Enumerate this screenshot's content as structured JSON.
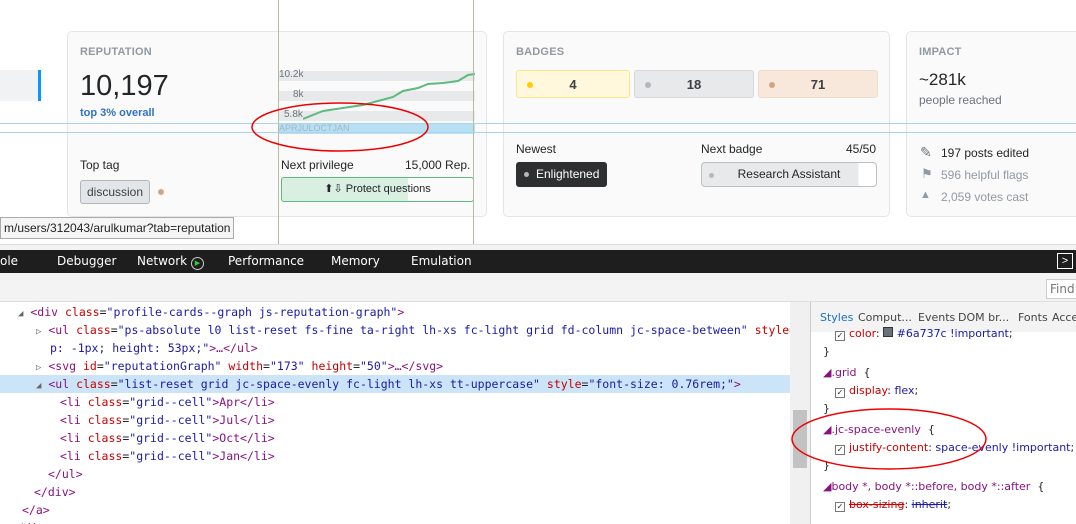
{
  "reputation": {
    "caption": "REPUTATION",
    "value": "10,197",
    "rank": "top 3% overall",
    "top_tag_label": "Top tag",
    "top_tag": "discussion",
    "graph": {
      "y_labels": [
        "10.2k",
        "8k",
        "5.8k"
      ],
      "x_labels": [
        "APR",
        "JUL",
        "OCT",
        "JAN"
      ],
      "line_color": "#5eba7d"
    },
    "next_privilege_label": "Next privilege",
    "next_privilege_rep": "15,000 Rep.",
    "next_privilege": "Protect questions"
  },
  "badges": {
    "caption": "BADGES",
    "gold": "4",
    "silver": "18",
    "bronze": "71",
    "newest_label": "Newest",
    "newest": "Enlightened",
    "next_label": "Next badge",
    "next_progress": "45/50",
    "next_badge": "Research Assistant",
    "colors": {
      "gold": "#ffcc01",
      "silver": "#b4b8bc",
      "bronze": "#d1a684"
    }
  },
  "impact": {
    "caption": "IMPACT",
    "reach": "~281k",
    "reach_label": "people reached",
    "edits": "197 posts edited",
    "flags": "596 helpful flags",
    "votes": "2,059 votes cast"
  },
  "tooltip": "m/users/312043/arulkumar?tab=reputation",
  "devtools": {
    "tabs": [
      "ole",
      "Debugger",
      "Network",
      "Performance",
      "Memory",
      "Emulation"
    ],
    "find_placeholder": "Find",
    "dom": [
      {
        "t": "<div ",
        "a": "class",
        "v": "\"profile-cards--graph js-reputation-graph\"",
        "e": ">"
      },
      {
        "t": "<ul ",
        "a": "class",
        "v": "\"ps-absolute l0 list-reset fs-fine ta-right lh-xs fc-light grid fd-column jc-space-between\" ",
        "a2": "style",
        "v2": "\"to"
      },
      {
        "t": "",
        "a": "",
        "v": "p: -1px; height: 53px;\"",
        "e": ">…</ul>"
      },
      {
        "t": "<svg ",
        "a": "id",
        "v": "\"reputationGraph\" ",
        "a2": "width",
        "v2": "\"173\" ",
        "a3": "height",
        "v3": "\"50\"",
        "e": ">…</svg>"
      },
      {
        "t": "<ul ",
        "a": "class",
        "v": "\"list-reset grid jc-space-evenly fc-light lh-xs tt-uppercase\" ",
        "a2": "style",
        "v2": "\"font-size: 0.76rem;\"",
        "e": ">"
      },
      {
        "t": "<li ",
        "a": "class",
        "v": "\"grid--cell\"",
        "e": ">Apr</li>"
      },
      {
        "t": "<li ",
        "a": "class",
        "v": "\"grid--cell\"",
        "e": ">Jul</li>"
      },
      {
        "t": "<li ",
        "a": "class",
        "v": "\"grid--cell\"",
        "e": ">Oct</li>"
      },
      {
        "t": "<li ",
        "a": "class",
        "v": "\"grid--cell\"",
        "e": ">Jan</li>"
      },
      {
        "t": "</ul>",
        "a": "",
        "v": "",
        "e": ""
      },
      {
        "t": "</div>",
        "a": "",
        "v": "",
        "e": ""
      },
      {
        "t": "</a>",
        "a": "",
        "v": "",
        "e": ""
      },
      {
        "t": "</div>",
        "a": "",
        "v": "",
        "e": ""
      }
    ],
    "styles_tabs": [
      "Styles",
      "Comput...",
      "Events",
      "DOM br...",
      "Fonts",
      "Acce"
    ],
    "rules": {
      "color_prop": "color",
      "color_val": "#6a737c !important",
      "grid_sel": ".grid",
      "grid_prop": "display",
      "grid_val": "flex",
      "jc_sel": ".jc-space-evenly",
      "jc_prop": "justify-content",
      "jc_val": "space-evenly !important",
      "body_sel": "body *, body *::before, body *::after",
      "bs_prop": "box-sizing",
      "bs_val": "inherit"
    }
  }
}
